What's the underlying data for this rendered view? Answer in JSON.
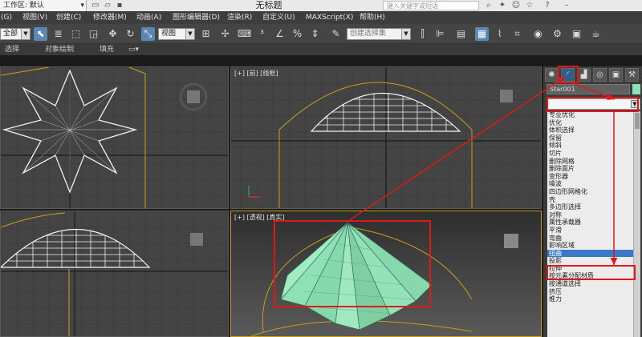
{
  "title_bar": {
    "workspace": "工作区: 默认",
    "title": "无标题",
    "search_placeholder": "键入关键字或短语"
  },
  "menu": [
    "(G)",
    "视图(V)",
    "创建(C)",
    "修改器(M)",
    "动画(A)",
    "图形编辑器(D)",
    "渲染(R)",
    "自定义(U)",
    "MAXScript(X)",
    "帮助(H)"
  ],
  "toolbar": {
    "filter_value": "全部",
    "view_value": "视图",
    "selection_set_placeholder": "创建选择集"
  },
  "ribbon": {
    "tabs": [
      "选择",
      "对象绘制",
      "填充"
    ]
  },
  "viewports": {
    "front_label": "[+] [前] [线框]",
    "perspective_label": "[+] [透视] [真实]"
  },
  "command_panel": {
    "object_name": "Star001",
    "color": "#8fe0b4",
    "modifiers": [
      "专业优化",
      "优化",
      "体积选择",
      "保留",
      "倾斜",
      "切片",
      "删除网格",
      "删除面片",
      "变形器",
      "噪波",
      "四边形网格化",
      "壳",
      "多边形选择",
      "对称",
      "属性承载器",
      "平滑",
      "弯曲",
      "影响区域",
      "扭曲",
      "投影",
      "拉伸",
      "按元素分配材质",
      "按通道选择",
      "挤压",
      "推力"
    ],
    "selected_modifier": "扭曲"
  },
  "annotation_color": "#e01818"
}
